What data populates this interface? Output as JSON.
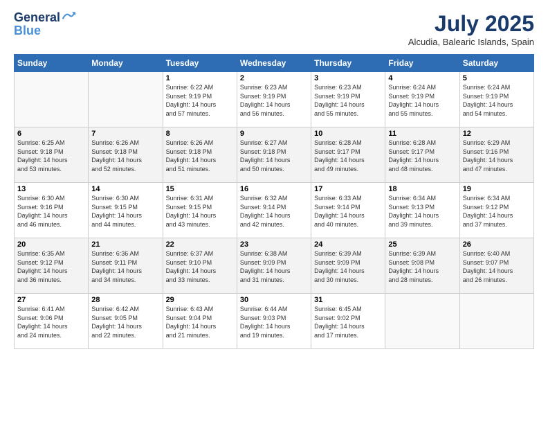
{
  "header": {
    "logo_line1": "General",
    "logo_line2": "Blue",
    "main_title": "July 2025",
    "subtitle": "Alcudia, Balearic Islands, Spain"
  },
  "calendar": {
    "headers": [
      "Sunday",
      "Monday",
      "Tuesday",
      "Wednesday",
      "Thursday",
      "Friday",
      "Saturday"
    ],
    "weeks": [
      [
        {
          "day": "",
          "info": ""
        },
        {
          "day": "",
          "info": ""
        },
        {
          "day": "1",
          "info": "Sunrise: 6:22 AM\nSunset: 9:19 PM\nDaylight: 14 hours\nand 57 minutes."
        },
        {
          "day": "2",
          "info": "Sunrise: 6:23 AM\nSunset: 9:19 PM\nDaylight: 14 hours\nand 56 minutes."
        },
        {
          "day": "3",
          "info": "Sunrise: 6:23 AM\nSunset: 9:19 PM\nDaylight: 14 hours\nand 55 minutes."
        },
        {
          "day": "4",
          "info": "Sunrise: 6:24 AM\nSunset: 9:19 PM\nDaylight: 14 hours\nand 55 minutes."
        },
        {
          "day": "5",
          "info": "Sunrise: 6:24 AM\nSunset: 9:19 PM\nDaylight: 14 hours\nand 54 minutes."
        }
      ],
      [
        {
          "day": "6",
          "info": "Sunrise: 6:25 AM\nSunset: 9:18 PM\nDaylight: 14 hours\nand 53 minutes."
        },
        {
          "day": "7",
          "info": "Sunrise: 6:26 AM\nSunset: 9:18 PM\nDaylight: 14 hours\nand 52 minutes."
        },
        {
          "day": "8",
          "info": "Sunrise: 6:26 AM\nSunset: 9:18 PM\nDaylight: 14 hours\nand 51 minutes."
        },
        {
          "day": "9",
          "info": "Sunrise: 6:27 AM\nSunset: 9:18 PM\nDaylight: 14 hours\nand 50 minutes."
        },
        {
          "day": "10",
          "info": "Sunrise: 6:28 AM\nSunset: 9:17 PM\nDaylight: 14 hours\nand 49 minutes."
        },
        {
          "day": "11",
          "info": "Sunrise: 6:28 AM\nSunset: 9:17 PM\nDaylight: 14 hours\nand 48 minutes."
        },
        {
          "day": "12",
          "info": "Sunrise: 6:29 AM\nSunset: 9:16 PM\nDaylight: 14 hours\nand 47 minutes."
        }
      ],
      [
        {
          "day": "13",
          "info": "Sunrise: 6:30 AM\nSunset: 9:16 PM\nDaylight: 14 hours\nand 46 minutes."
        },
        {
          "day": "14",
          "info": "Sunrise: 6:30 AM\nSunset: 9:15 PM\nDaylight: 14 hours\nand 44 minutes."
        },
        {
          "day": "15",
          "info": "Sunrise: 6:31 AM\nSunset: 9:15 PM\nDaylight: 14 hours\nand 43 minutes."
        },
        {
          "day": "16",
          "info": "Sunrise: 6:32 AM\nSunset: 9:14 PM\nDaylight: 14 hours\nand 42 minutes."
        },
        {
          "day": "17",
          "info": "Sunrise: 6:33 AM\nSunset: 9:14 PM\nDaylight: 14 hours\nand 40 minutes."
        },
        {
          "day": "18",
          "info": "Sunrise: 6:34 AM\nSunset: 9:13 PM\nDaylight: 14 hours\nand 39 minutes."
        },
        {
          "day": "19",
          "info": "Sunrise: 6:34 AM\nSunset: 9:12 PM\nDaylight: 14 hours\nand 37 minutes."
        }
      ],
      [
        {
          "day": "20",
          "info": "Sunrise: 6:35 AM\nSunset: 9:12 PM\nDaylight: 14 hours\nand 36 minutes."
        },
        {
          "day": "21",
          "info": "Sunrise: 6:36 AM\nSunset: 9:11 PM\nDaylight: 14 hours\nand 34 minutes."
        },
        {
          "day": "22",
          "info": "Sunrise: 6:37 AM\nSunset: 9:10 PM\nDaylight: 14 hours\nand 33 minutes."
        },
        {
          "day": "23",
          "info": "Sunrise: 6:38 AM\nSunset: 9:09 PM\nDaylight: 14 hours\nand 31 minutes."
        },
        {
          "day": "24",
          "info": "Sunrise: 6:39 AM\nSunset: 9:09 PM\nDaylight: 14 hours\nand 30 minutes."
        },
        {
          "day": "25",
          "info": "Sunrise: 6:39 AM\nSunset: 9:08 PM\nDaylight: 14 hours\nand 28 minutes."
        },
        {
          "day": "26",
          "info": "Sunrise: 6:40 AM\nSunset: 9:07 PM\nDaylight: 14 hours\nand 26 minutes."
        }
      ],
      [
        {
          "day": "27",
          "info": "Sunrise: 6:41 AM\nSunset: 9:06 PM\nDaylight: 14 hours\nand 24 minutes."
        },
        {
          "day": "28",
          "info": "Sunrise: 6:42 AM\nSunset: 9:05 PM\nDaylight: 14 hours\nand 22 minutes."
        },
        {
          "day": "29",
          "info": "Sunrise: 6:43 AM\nSunset: 9:04 PM\nDaylight: 14 hours\nand 21 minutes."
        },
        {
          "day": "30",
          "info": "Sunrise: 6:44 AM\nSunset: 9:03 PM\nDaylight: 14 hours\nand 19 minutes."
        },
        {
          "day": "31",
          "info": "Sunrise: 6:45 AM\nSunset: 9:02 PM\nDaylight: 14 hours\nand 17 minutes."
        },
        {
          "day": "",
          "info": ""
        },
        {
          "day": "",
          "info": ""
        }
      ]
    ]
  }
}
